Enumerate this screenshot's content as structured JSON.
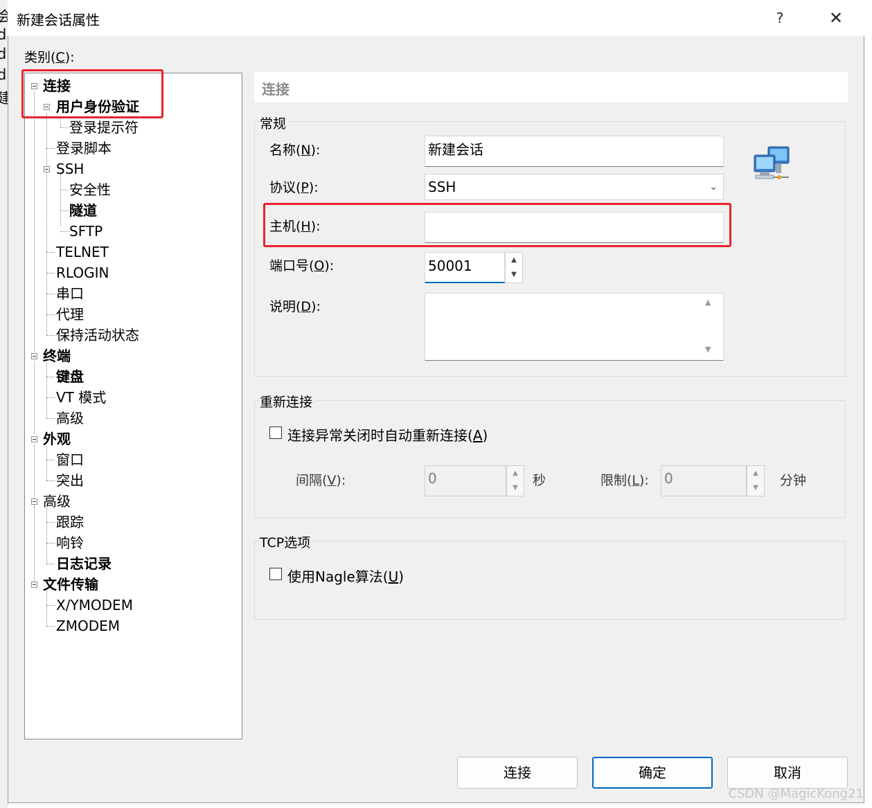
{
  "background_window": {
    "fragments": [
      "会i",
      "d",
      "d",
      "d",
      "建"
    ]
  },
  "dialog": {
    "title": "新建会话属性",
    "help": "?",
    "close": "✕",
    "category_label_prefix": "类别(",
    "category_label_key": "C",
    "category_label_suffix": "):"
  },
  "tree": {
    "connection": "连接",
    "auth": "用户身份验证",
    "login_prompt": "登录提示符",
    "login_script": "登录脚本",
    "ssh": "SSH",
    "security": "安全性",
    "tunnel": "隧道",
    "sftp": "SFTP",
    "telnet": "TELNET",
    "rlogin": "RLOGIN",
    "serial": "串口",
    "proxy": "代理",
    "keepalive": "保持活动状态",
    "terminal": "终端",
    "keyboard": "键盘",
    "vt_mode": "VT 模式",
    "advanced_term": "高级",
    "appearance": "外观",
    "window": "窗口",
    "highlight": "突出",
    "advanced": "高级",
    "trace": "跟踪",
    "bell": "响铃",
    "logging": "日志记录",
    "file_transfer": "文件传输",
    "xymodem": "X/YMODEM",
    "zmodem": "ZMODEM"
  },
  "panel": {
    "header": "连接",
    "general_group": "常规",
    "name_label": [
      "名称(",
      "N",
      "):"
    ],
    "name_value": "新建会话",
    "protocol_label": [
      "协议(",
      "P",
      "):"
    ],
    "protocol_value": "SSH",
    "host_label": [
      "主机(",
      "H",
      "):"
    ],
    "host_value": "",
    "port_label": [
      "端口号(",
      "O",
      "):"
    ],
    "port_value": "50001",
    "desc_label": [
      "说明(",
      "D",
      "):"
    ],
    "desc_value": "",
    "reconnect_group": "重新连接",
    "auto_reconnect": [
      "连接异常关闭时自动重新连接(",
      "A",
      ")"
    ],
    "auto_reconnect_checked": false,
    "interval_label": [
      "间隔(",
      "V",
      "):"
    ],
    "interval_value": "0",
    "seconds": "秒",
    "limit_label": [
      "限制(",
      "L",
      "):"
    ],
    "limit_value": "0",
    "minutes": "分钟",
    "tcp_group": "TCP选项",
    "nagle": [
      "使用Nagle算法(",
      "U",
      ")"
    ],
    "nagle_checked": false
  },
  "buttons": {
    "connect": "连接",
    "ok": "确定",
    "cancel": "取消"
  },
  "watermark": "CSDN @MagicKong21",
  "colors": {
    "highlight_box": "#e8232b",
    "dialog_bg": "#f0f0f0",
    "default_button_border": "#0067c0"
  }
}
